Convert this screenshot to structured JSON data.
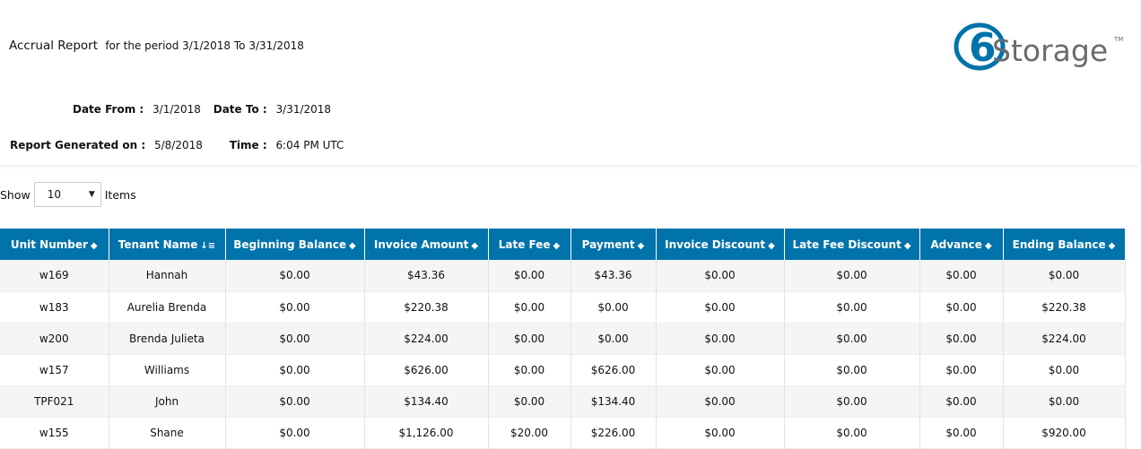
{
  "report": {
    "title": "Accrual Report",
    "period": "for the period 3/1/2018 To 3/31/2018",
    "date_from_label": "Date From :",
    "date_from": "3/1/2018",
    "date_to_label": "Date To :",
    "date_to": "3/31/2018",
    "generated_label": "Report Generated on :",
    "generated_on": "5/8/2018",
    "time_label": "Time :",
    "time": "6:04 PM UTC"
  },
  "logo": {
    "digit": "6",
    "word": "Storage",
    "tm": "TM",
    "brand_color": "#0073aa"
  },
  "show": {
    "label": "Show",
    "selected": "10",
    "suffix": "Items"
  },
  "table": {
    "columns": [
      {
        "label": "Unit Number",
        "sort_icon": "sort-icon"
      },
      {
        "label": "Tenant Name",
        "sort_icon": "sort-alpha-down-icon"
      },
      {
        "label": "Beginning Balance",
        "sort_icon": "sort-icon"
      },
      {
        "label": "Invoice Amount",
        "sort_icon": "sort-icon"
      },
      {
        "label": "Late Fee",
        "sort_icon": "sort-icon"
      },
      {
        "label": "Payment",
        "sort_icon": "sort-icon"
      },
      {
        "label": "Invoice Discount",
        "sort_icon": "sort-icon"
      },
      {
        "label": "Late Fee Discount",
        "sort_icon": "sort-icon"
      },
      {
        "label": "Advance",
        "sort_icon": "sort-icon"
      },
      {
        "label": "Ending Balance",
        "sort_icon": "sort-icon"
      }
    ],
    "rows": [
      [
        "w169",
        "Hannah",
        "$0.00",
        "$43.36",
        "$0.00",
        "$43.36",
        "$0.00",
        "$0.00",
        "$0.00",
        "$0.00"
      ],
      [
        "w183",
        "Aurelia Brenda",
        "$0.00",
        "$220.38",
        "$0.00",
        "$0.00",
        "$0.00",
        "$0.00",
        "$0.00",
        "$220.38"
      ],
      [
        "w200",
        "Brenda Julieta",
        "$0.00",
        "$224.00",
        "$0.00",
        "$0.00",
        "$0.00",
        "$0.00",
        "$0.00",
        "$224.00"
      ],
      [
        "w157",
        "Williams",
        "$0.00",
        "$626.00",
        "$0.00",
        "$626.00",
        "$0.00",
        "$0.00",
        "$0.00",
        "$0.00"
      ],
      [
        "TPF021",
        "John",
        "$0.00",
        "$134.40",
        "$0.00",
        "$134.40",
        "$0.00",
        "$0.00",
        "$0.00",
        "$0.00"
      ],
      [
        "w155",
        "Shane",
        "$0.00",
        "$1,126.00",
        "$20.00",
        "$226.00",
        "$0.00",
        "$0.00",
        "$0.00",
        "$920.00"
      ]
    ]
  }
}
